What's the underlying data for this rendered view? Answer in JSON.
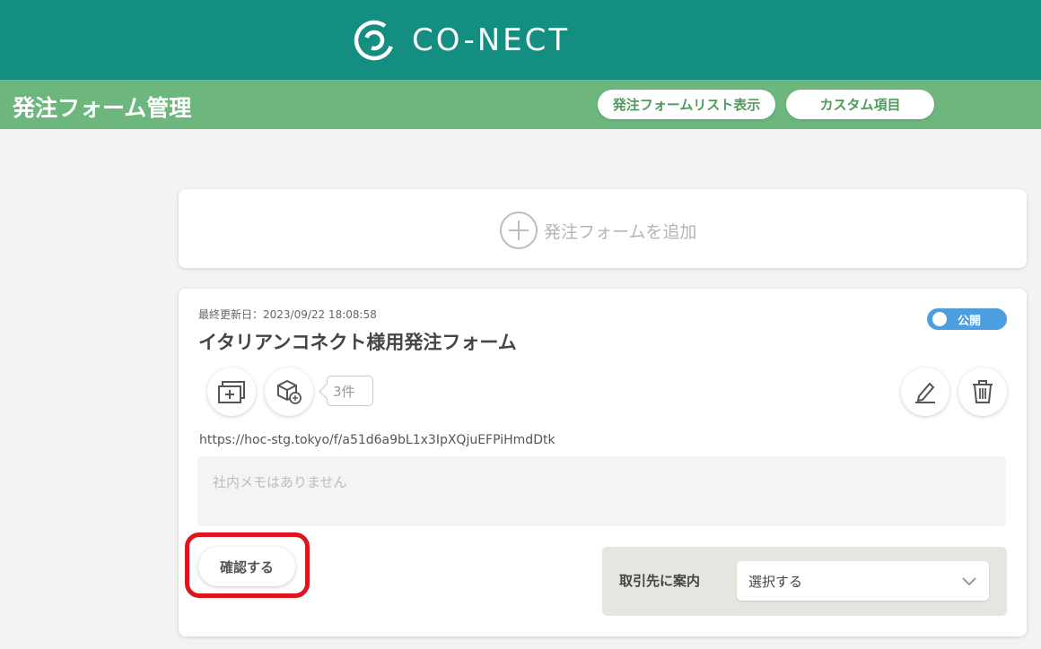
{
  "header": {
    "logo_text": "CO-NECT"
  },
  "subheader": {
    "title": "発注フォーム管理",
    "buttons": {
      "list_view": "発注フォームリスト表示",
      "custom_fields": "カスタム項目"
    }
  },
  "add_form": {
    "label": "発注フォームを追加"
  },
  "form_card": {
    "last_updated": "最終更新日：2023/09/22 18:08:58",
    "name": "イタリアンコネクト様用発注フォーム",
    "status_label": "公開",
    "product_count": "3件",
    "url": "https://hoc-stg.tokyo/f/a51d6a9bL1x3IpXQjuEFPiHmdDtk",
    "memo_placeholder": "社内メモはありません",
    "confirm_label": "確認する",
    "partner_label": "取引先に案内",
    "partner_select_value": "選択する"
  },
  "colors": {
    "header_bg": "#148e80",
    "subheader_bg": "#6db77f",
    "toggle_on": "#4c9ee0",
    "highlight": "#e0141e"
  },
  "icons": [
    "conect-logo-icon",
    "plus-circle-icon",
    "add-window-icon",
    "box-add-icon",
    "pen-icon",
    "trash-icon",
    "chevron-down-icon"
  ]
}
